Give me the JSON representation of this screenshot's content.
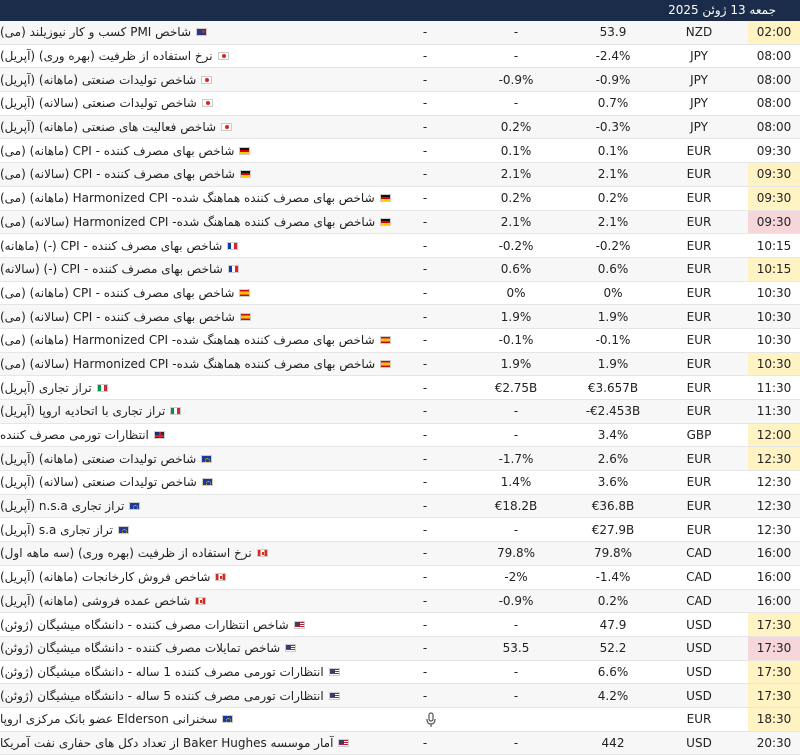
{
  "header": {
    "date": "جمعه 13 ژوئن 2025"
  },
  "rows": [
    {
      "time": "02:00",
      "hl": "y",
      "cur": "NZD",
      "act": "53.9",
      "fc": "-",
      "prv": "-",
      "flag": "nz",
      "event": "شاخص PMI کسب و کار نیوزیلند (می)"
    },
    {
      "time": "08:00",
      "hl": "",
      "cur": "JPY",
      "act": "-2.4%",
      "fc": "-",
      "prv": "-",
      "flag": "jp",
      "event": "نرخ استفاده از ظرفیت (بهره وری) (آپریل)"
    },
    {
      "time": "08:00",
      "hl": "",
      "cur": "JPY",
      "act": "-0.9%",
      "fc": "-0.9%",
      "prv": "-",
      "flag": "jp",
      "event": "شاخص تولیدات صنعتی (ماهانه) (آپریل)"
    },
    {
      "time": "08:00",
      "hl": "",
      "cur": "JPY",
      "act": "0.7%",
      "fc": "-",
      "prv": "-",
      "flag": "jp",
      "event": "شاخص تولیدات صنعتی (سالانه) (آپریل)"
    },
    {
      "time": "08:00",
      "hl": "",
      "cur": "JPY",
      "act": "-0.3%",
      "fc": "0.2%",
      "prv": "-",
      "flag": "jp",
      "event": "شاخص فعالیت های صنعتی (ماهانه) (آپریل)"
    },
    {
      "time": "09:30",
      "hl": "",
      "cur": "EUR",
      "act": "0.1%",
      "fc": "0.1%",
      "prv": "-",
      "flag": "de",
      "event": "شاخص بهای مصرف کننده - CPI (ماهانه) (می)"
    },
    {
      "time": "09:30",
      "hl": "y",
      "cur": "EUR",
      "act": "2.1%",
      "fc": "2.1%",
      "prv": "-",
      "flag": "de",
      "event": "شاخص بهای مصرف کننده - CPI (سالانه) (می)"
    },
    {
      "time": "09:30",
      "hl": "y",
      "cur": "EUR",
      "act": "0.2%",
      "fc": "0.2%",
      "prv": "-",
      "flag": "de",
      "event": "شاخص بهای مصرف کننده هماهنگ شده- Harmonized CPI (ماهانه) (می)"
    },
    {
      "time": "09:30",
      "hl": "r",
      "cur": "EUR",
      "act": "2.1%",
      "fc": "2.1%",
      "prv": "-",
      "flag": "de",
      "event": "شاخص بهای مصرف کننده هماهنگ شده- Harmonized CPI (سالانه) (می)"
    },
    {
      "time": "10:15",
      "hl": "",
      "cur": "EUR",
      "act": "-0.2%",
      "fc": "-0.2%",
      "prv": "-",
      "flag": "fr",
      "event": "شاخص بهای مصرف کننده - CPI (-) (ماهانه)"
    },
    {
      "time": "10:15",
      "hl": "y",
      "cur": "EUR",
      "act": "0.6%",
      "fc": "0.6%",
      "prv": "-",
      "flag": "fr",
      "event": "شاخص بهای مصرف کننده - CPI (-) (سالانه)"
    },
    {
      "time": "10:30",
      "hl": "",
      "cur": "EUR",
      "act": "0%",
      "fc": "0%",
      "prv": "-",
      "flag": "es",
      "event": "شاخص بهای مصرف کننده - CPI (ماهانه) (می)"
    },
    {
      "time": "10:30",
      "hl": "",
      "cur": "EUR",
      "act": "1.9%",
      "fc": "1.9%",
      "prv": "-",
      "flag": "es",
      "event": "شاخص بهای مصرف کننده - CPI (سالانه) (می)"
    },
    {
      "time": "10:30",
      "hl": "",
      "cur": "EUR",
      "act": "-0.1%",
      "fc": "-0.1%",
      "prv": "-",
      "flag": "es",
      "event": "شاخص بهای مصرف کننده هماهنگ شده- Harmonized CPI (ماهانه) (می)"
    },
    {
      "time": "10:30",
      "hl": "y",
      "cur": "EUR",
      "act": "1.9%",
      "fc": "1.9%",
      "prv": "-",
      "flag": "es",
      "event": "شاخص بهای مصرف کننده هماهنگ شده- Harmonized CPI (سالانه) (می)"
    },
    {
      "time": "11:30",
      "hl": "",
      "cur": "EUR",
      "act": "€3.657B",
      "fc": "€2.75B",
      "prv": "-",
      "flag": "it",
      "event": "تراز تجاری (آپریل)"
    },
    {
      "time": "11:30",
      "hl": "",
      "cur": "EUR",
      "act": "-€2.453B",
      "fc": "-",
      "prv": "-",
      "flag": "it",
      "event": "تراز تجاری با اتحادیه اروپا (آپریل)"
    },
    {
      "time": "12:00",
      "hl": "y",
      "cur": "GBP",
      "act": "3.4%",
      "fc": "-",
      "prv": "-",
      "flag": "gb",
      "event": "انتظارات تورمی مصرف کننده"
    },
    {
      "time": "12:30",
      "hl": "y",
      "cur": "EUR",
      "act": "2.6%",
      "fc": "-1.7%",
      "prv": "-",
      "flag": "eu",
      "event": "شاخص تولیدات صنعتی (ماهانه) (آپریل)"
    },
    {
      "time": "12:30",
      "hl": "",
      "cur": "EUR",
      "act": "3.6%",
      "fc": "1.4%",
      "prv": "-",
      "flag": "eu",
      "event": "شاخص تولیدات صنعتی (سالانه) (آپریل)"
    },
    {
      "time": "12:30",
      "hl": "",
      "cur": "EUR",
      "act": "€36.8B",
      "fc": "€18.2B",
      "prv": "-",
      "flag": "eu",
      "event": "تراز تجاری n.s.a (آپریل)"
    },
    {
      "time": "12:30",
      "hl": "",
      "cur": "EUR",
      "act": "€27.9B",
      "fc": "-",
      "prv": "-",
      "flag": "eu",
      "event": "تراز تجاری s.a (آپریل)"
    },
    {
      "time": "16:00",
      "hl": "",
      "cur": "CAD",
      "act": "79.8%",
      "fc": "79.8%",
      "prv": "-",
      "flag": "ca",
      "event": "نرخ استفاده از ظرفیت (بهره وری) (سه ماهه اول)"
    },
    {
      "time": "16:00",
      "hl": "",
      "cur": "CAD",
      "act": "-1.4%",
      "fc": "-2%",
      "prv": "-",
      "flag": "ca",
      "event": "شاخص فروش کارخانجات (ماهانه) (آپریل)"
    },
    {
      "time": "16:00",
      "hl": "",
      "cur": "CAD",
      "act": "0.2%",
      "fc": "-0.9%",
      "prv": "-",
      "flag": "ca",
      "event": "شاخص عمده فروشی (ماهانه) (آپریل)"
    },
    {
      "time": "17:30",
      "hl": "y",
      "cur": "USD",
      "act": "47.9",
      "fc": "-",
      "prv": "-",
      "flag": "us",
      "event": "شاخص انتظارات مصرف کننده - دانشگاه میشیگان (ژوئن)"
    },
    {
      "time": "17:30",
      "hl": "r",
      "cur": "USD",
      "act": "52.2",
      "fc": "53.5",
      "prv": "-",
      "flag": "us",
      "event": "شاخص تمایلات مصرف کننده - دانشگاه میشیگان (ژوئن)"
    },
    {
      "time": "17:30",
      "hl": "y",
      "cur": "USD",
      "act": "6.6%",
      "fc": "-",
      "prv": "-",
      "flag": "us",
      "event": "انتظارات تورمی مصرف کننده 1 ساله - دانشگاه میشیگان (ژوئن)"
    },
    {
      "time": "17:30",
      "hl": "y",
      "cur": "USD",
      "act": "4.2%",
      "fc": "-",
      "prv": "-",
      "flag": "us",
      "event": "انتظارات تورمی مصرف کننده 5 ساله - دانشگاه میشیگان (ژوئن)"
    },
    {
      "time": "18:30",
      "hl": "y",
      "cur": "EUR",
      "act": "",
      "fc": "",
      "prv": "",
      "flag": "eu",
      "mic": true,
      "event": "سخنرانی Elderson عضو بانک مرکزی اروپا"
    },
    {
      "time": "20:30",
      "hl": "",
      "cur": "USD",
      "act": "442",
      "fc": "-",
      "prv": "-",
      "flag": "us",
      "event": "آمار موسسه Baker Hughes از تعداد دکل های حفاری نفت آمریکا"
    }
  ]
}
